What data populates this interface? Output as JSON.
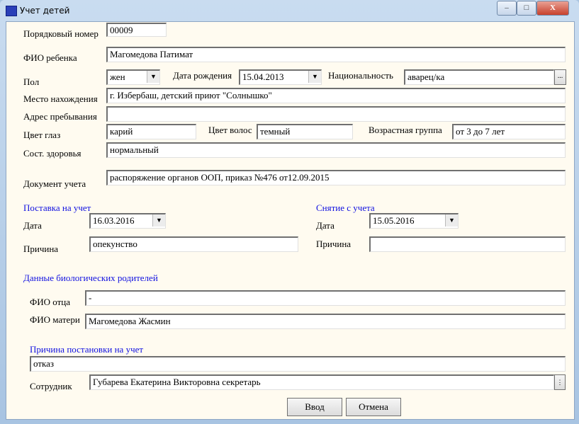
{
  "window": {
    "title": "Учет детей",
    "minimize": "–",
    "maximize": "□",
    "close": "X"
  },
  "form": {
    "number_label": "Порядковый номер",
    "number": "00009",
    "name_label": "ФИО ребенка",
    "name": "Магомедова Патимат",
    "sex_label": "Пол",
    "sex": "жен",
    "birth_label": "Дата рождения",
    "birth": "15.04.2013",
    "nation_label": "Национальность",
    "nation": "аварец/ка",
    "nation_btn": "...",
    "location_label": "Место нахождения",
    "location": "г. Избербаш, детский приют \"Солнышко\"",
    "address_label": "Адрес пребывания",
    "address": "",
    "eyes_label": "Цвет глаз",
    "eyes": "карий",
    "hair_label": "Цвет волос",
    "hair": "темный",
    "age_label": "Возрастная группа",
    "age": "от 3 до 7 лет",
    "health_label": "Сост. здоровья",
    "health": "нормальный",
    "doc_label": "Документ учета",
    "doc": "распоряжение органов ООП, приказ №476 от12.09.2015"
  },
  "reg": {
    "title": "Поставка на учет",
    "date_label": "Дата",
    "date": "16.03.2016",
    "reason_label": "Причина",
    "reason": "опекунство"
  },
  "unreg": {
    "title": "Снятие с учета",
    "date_label": "Дата",
    "date": "15.05.2016",
    "reason_label": "Причина",
    "reason": ""
  },
  "parents": {
    "title": "Данные биологических родителей",
    "father_label": "ФИО отца",
    "father": "-",
    "mother_label": "ФИО матери",
    "mother": "Магомедова Жасмин"
  },
  "cause": {
    "title": "Причина постановки на учет",
    "value": "отказ"
  },
  "employee": {
    "label": "Сотрудник",
    "value": "Губарева Екатерина Викторовна  секретарь"
  },
  "buttons": {
    "ok": "Ввод",
    "cancel": "Отмена"
  }
}
